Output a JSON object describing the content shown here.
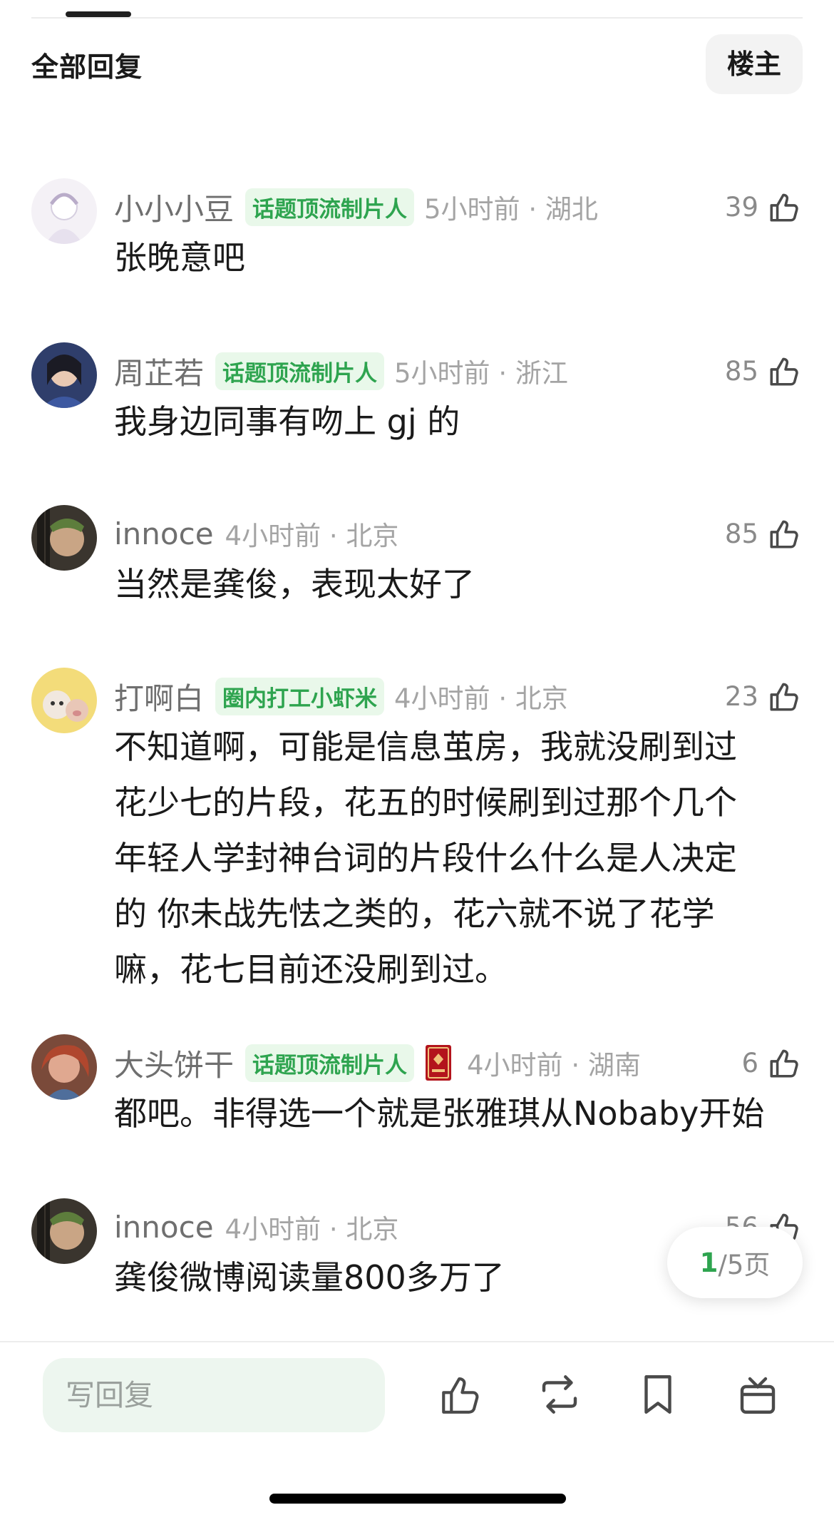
{
  "header": {
    "title": "全部回复",
    "op_button": "楼主"
  },
  "comments": [
    {
      "name": "小小小豆",
      "badge": "话题顶流制片人",
      "meta": "5小时前 · 湖北",
      "likes": "39",
      "lines": [
        "张晚意吧"
      ]
    },
    {
      "name": "周芷若",
      "badge": "话题顶流制片人",
      "meta": "5小时前 · 浙江",
      "likes": "85",
      "lines": [
        "我身边同事有吻上 gj 的"
      ]
    },
    {
      "name": "innoce",
      "badge": "",
      "meta": "4小时前 · 北京",
      "likes": "85",
      "lines": [
        "当然是龚俊，表现太好了"
      ]
    },
    {
      "name": "打啊白",
      "badge": "圈内打工小虾米",
      "meta": "4小时前 · 北京",
      "likes": "23",
      "lines": [
        "不知道啊，可能是信息茧房，我就没刷到过",
        "花少七的片段，花五的时候刷到过那个几个",
        "年轻人学封神台词的片段什么什么是人决定",
        "的 你未战先怯之类的，花六就不说了花学",
        "嘛，花七目前还没刷到过。"
      ]
    },
    {
      "name": "大头饼干",
      "badge": "话题顶流制片人",
      "meta": "4小时前 · 湖南",
      "likes": "6",
      "lines": [
        "都吧。非得选一个就是张雅琪从Nobaby开始"
      ]
    },
    {
      "name": "innoce",
      "badge": "",
      "meta": "4小时前 · 北京",
      "likes": "56",
      "lines": [
        "龚俊微博阅读量800多万了"
      ]
    }
  ],
  "pager": {
    "current": "1",
    "total_text": "/5页"
  },
  "bottom_bar": {
    "reply_placeholder": "写回复"
  },
  "icons": {
    "like": "thumbs-up-icon",
    "repost": "repost-icon",
    "bookmark": "bookmark-icon",
    "gift": "gift-icon"
  },
  "colors": {
    "accent_green": "#2ea44f",
    "badge_bg": "#e9f8ea",
    "input_bg": "#edf6ef"
  }
}
